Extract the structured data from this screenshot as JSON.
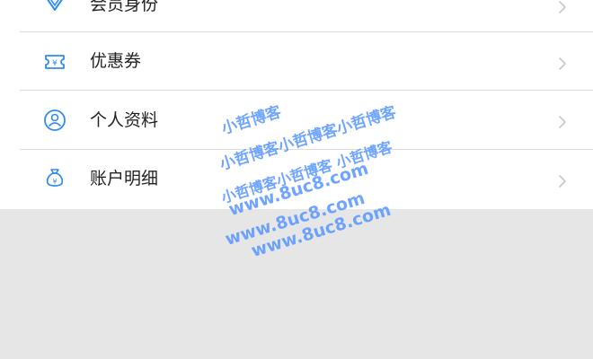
{
  "menu": {
    "items": [
      {
        "label": "会员身份",
        "icon": "diamond-icon"
      },
      {
        "label": "优惠券",
        "icon": "coupon-icon"
      },
      {
        "label": "个人资料",
        "icon": "user-profile-icon"
      },
      {
        "label": "账户明细",
        "icon": "money-bag-icon"
      }
    ]
  },
  "watermark": {
    "lines": [
      "小哲博客",
      "小哲博客小哲博客小哲博客",
      "小哲博客小哲博客 小哲博客",
      "www.8uc8.com",
      "www.8uc8.com",
      "www.8uc8.com"
    ]
  },
  "colors": {
    "icon_blue": "#2f8cf0",
    "chevron": "#c7c7cc",
    "text": "#222222",
    "background": "#e6e6e6",
    "watermark": "#3782ff"
  }
}
